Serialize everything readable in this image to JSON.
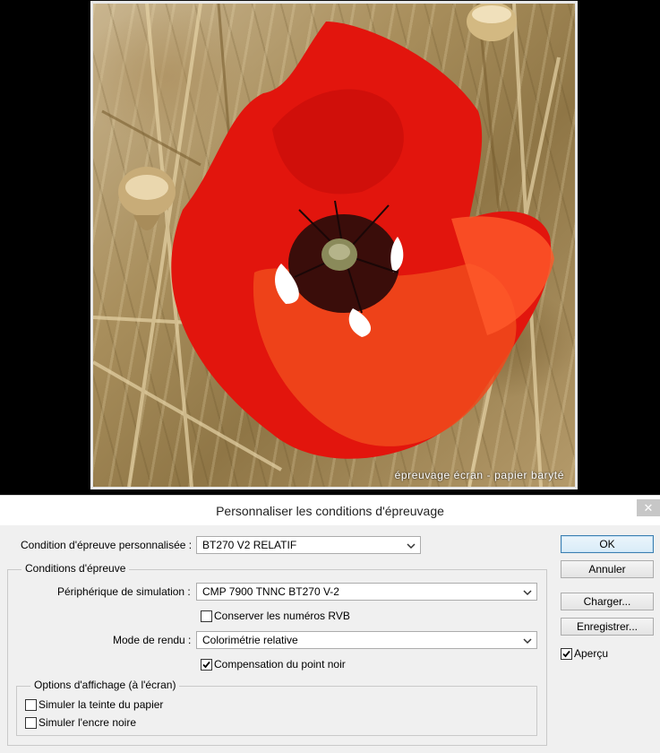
{
  "photo": {
    "caption": "épreuvage écran - papier baryté"
  },
  "dialog": {
    "title": "Personnaliser les conditions d'épreuvage",
    "close_symbol": "✕",
    "custom_condition_label": "Condition d'épreuve personnalisée :",
    "custom_condition_value": "BT270 V2 RELATIF",
    "proof_conditions": {
      "title": "Conditions d'épreuve",
      "device_label": "Périphérique de simulation :",
      "device_value": "CMP 7900 TNNC BT270 V-2",
      "preserve_rgb_label": "Conserver les numéros RVB",
      "preserve_rgb_checked": false,
      "rendering_label": "Mode de rendu :",
      "rendering_value": "Colorimétrie relative",
      "black_point_label": "Compensation du point noir",
      "black_point_checked": true
    },
    "display_options": {
      "title": "Options d'affichage (à l'écran)",
      "paper_color_label": "Simuler la teinte du papier",
      "paper_color_checked": false,
      "black_ink_label": "Simuler l'encre noire",
      "black_ink_checked": false
    },
    "buttons": {
      "ok": "OK",
      "cancel": "Annuler",
      "load": "Charger...",
      "save": "Enregistrer..."
    },
    "preview_label": "Aperçu",
    "preview_checked": true
  }
}
